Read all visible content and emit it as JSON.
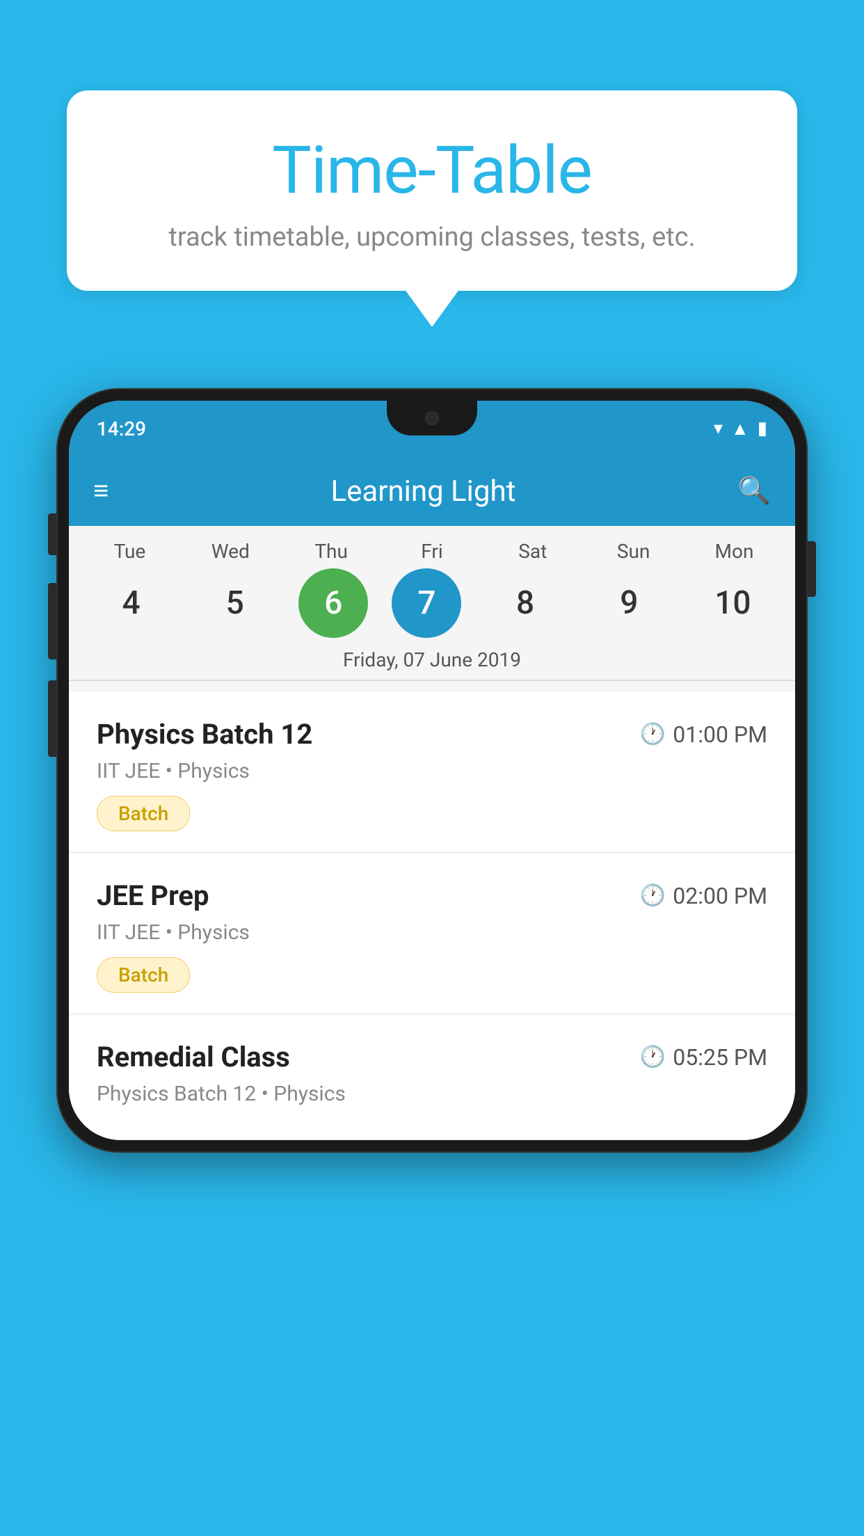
{
  "background_color": "#29B6E8",
  "bubble": {
    "title": "Time-Table",
    "subtitle": "track timetable, upcoming classes, tests, etc."
  },
  "phone": {
    "status_bar": {
      "time": "14:29"
    },
    "app_bar": {
      "title": "Learning Light"
    },
    "calendar": {
      "days": [
        {
          "label": "Tue",
          "num": "4"
        },
        {
          "label": "Wed",
          "num": "5"
        },
        {
          "label": "Thu",
          "num": "6",
          "state": "today"
        },
        {
          "label": "Fri",
          "num": "7",
          "state": "selected"
        },
        {
          "label": "Sat",
          "num": "8"
        },
        {
          "label": "Sun",
          "num": "9"
        },
        {
          "label": "Mon",
          "num": "10"
        }
      ],
      "selected_date_label": "Friday, 07 June 2019"
    },
    "classes": [
      {
        "name": "Physics Batch 12",
        "time": "01:00 PM",
        "meta": "IIT JEE • Physics",
        "badge": "Batch"
      },
      {
        "name": "JEE Prep",
        "time": "02:00 PM",
        "meta": "IIT JEE • Physics",
        "badge": "Batch"
      },
      {
        "name": "Remedial Class",
        "time": "05:25 PM",
        "meta": "Physics Batch 12 • Physics",
        "badge": ""
      }
    ]
  }
}
